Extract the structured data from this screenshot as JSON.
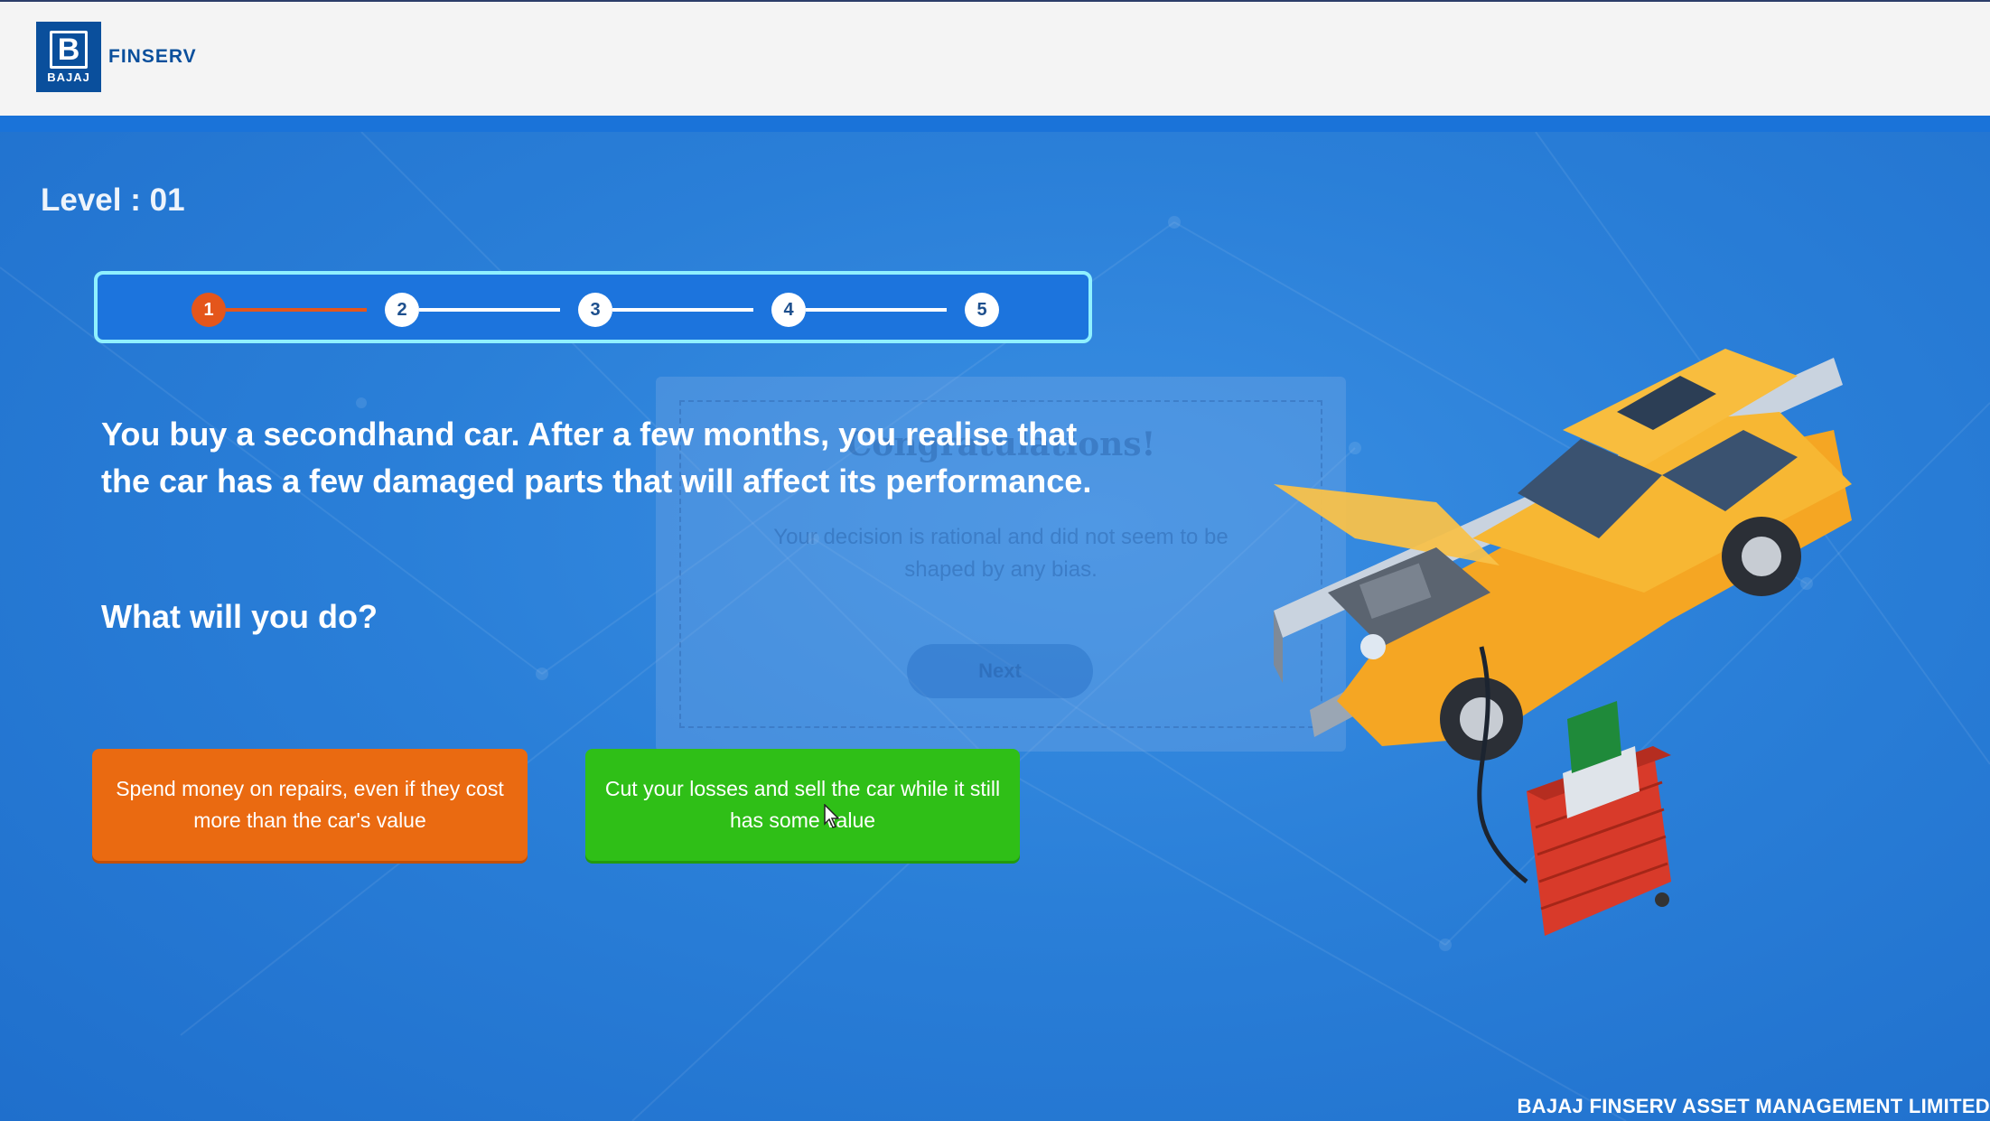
{
  "brand": {
    "logo_mark": "B",
    "logo_small": "BAJAJ",
    "logo_text": "FINSERV"
  },
  "level_label": "Level : 01",
  "progress": {
    "steps": [
      "1",
      "2",
      "3",
      "4",
      "5"
    ],
    "current_step": 1,
    "active_color": "#e4561b"
  },
  "question": "You buy a secondhand car. After a few months, you realise that the car has a few damaged parts that will affect its performance.",
  "prompt": "What will you do?",
  "choices": [
    {
      "label": "Spend money on repairs, even if they cost more than the car's value",
      "color": "#ea6a11"
    },
    {
      "label": "Cut your losses and sell the car while it still has some value",
      "color": "#2fbf17"
    }
  ],
  "faded_dialog": {
    "title": "Congratulations!",
    "message": "Your decision is rational and did not seem to be shaped by any bias.",
    "button": "Next"
  },
  "illustration": "car-on-repair-lift-illustration",
  "footer": "BAJAJ FINSERV ASSET MANAGEMENT LIMITED",
  "colors": {
    "header_bg": "#f4f4f4",
    "accent_bar": "#1a73d9",
    "stage_bg": "#2a7fd8",
    "progress_border": "#8ff0ff"
  }
}
